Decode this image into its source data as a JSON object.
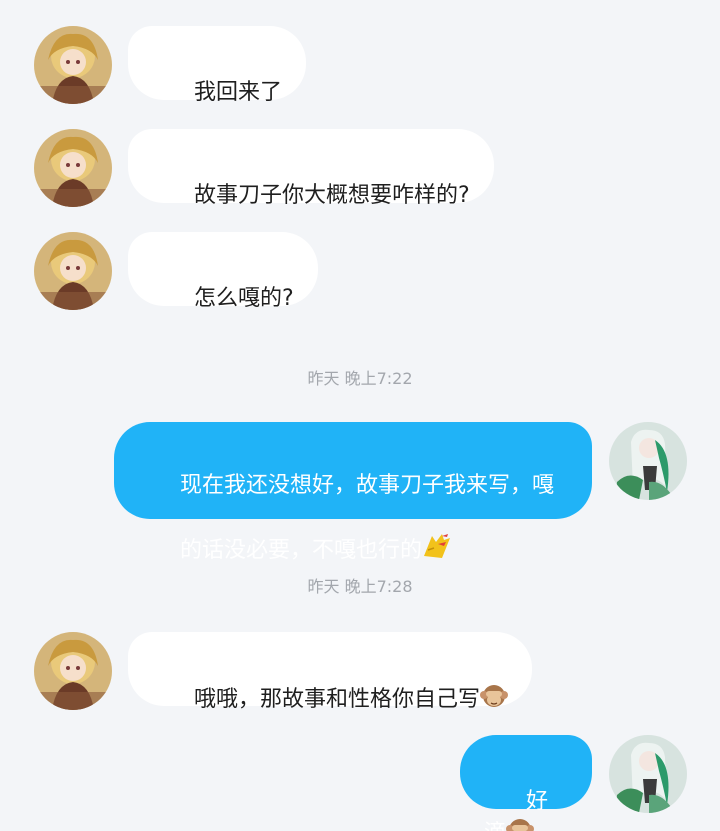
{
  "colors": {
    "background": "#f3f5f8",
    "incoming_bubble": "#ffffff",
    "outgoing_bubble": "#20b3f7",
    "timestamp_text": "#a3a7ad"
  },
  "messages": [
    {
      "direction": "in",
      "text": "我回来了"
    },
    {
      "direction": "in",
      "text": "故事刀子你大概想要咋样的?"
    },
    {
      "direction": "in",
      "text": "怎么嘎的?"
    },
    {
      "timestamp": "昨天 晚上7:22"
    },
    {
      "direction": "out",
      "text_line1": "现在我还没想好，故事刀子我来写，嘎",
      "text_line2": "的话没必要，不嘎也行的",
      "emoji": "zzz-sleeping-icon"
    },
    {
      "timestamp": "昨天 晚上7:28"
    },
    {
      "direction": "in",
      "text": "哦哦，那故事和性格你自己写",
      "emoji": "see-no-evil-monkey-icon"
    },
    {
      "direction": "out",
      "text": "好滴",
      "emoji": "see-no-evil-monkey-icon"
    }
  ]
}
